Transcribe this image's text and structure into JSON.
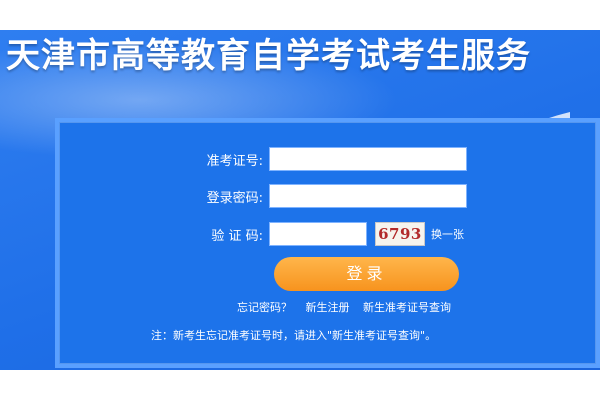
{
  "header": {
    "title": "天津市高等教育自学考试考生服务"
  },
  "form": {
    "exam_id_label": "准考证号:",
    "exam_id_value": "",
    "password_label": "登录密码:",
    "password_value": "",
    "captcha_label": "验 证 码:",
    "captcha_value": "",
    "captcha_image_text": "6793",
    "refresh_label": "换一张",
    "login_label": "登录"
  },
  "links": {
    "forgot_password": "忘记密码？",
    "new_register": "新生注册",
    "new_id_query": "新生准考证号查询"
  },
  "note": "注：新考生忘记准考证号时，请进入\"新生准考证号查询\"。",
  "colors": {
    "banner_blue": "#1f6fe8",
    "login_orange": "#f7931e",
    "captcha_red": "#b22a2a"
  }
}
